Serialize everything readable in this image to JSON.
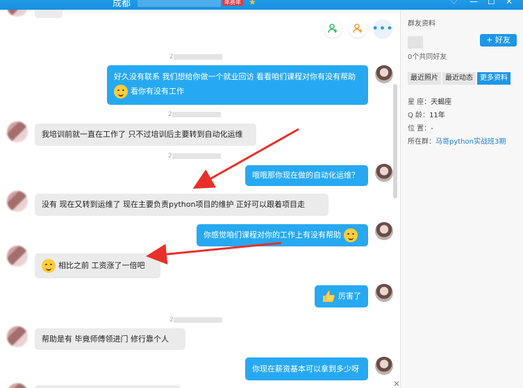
{
  "window": {
    "title_prefix": "成都",
    "vip_badge": "年费年",
    "controls": [
      "♡",
      "—",
      "☐",
      "✕"
    ]
  },
  "chat": {
    "messages": [
      {
        "side": "out",
        "text": "好久没有联系 我们想给你做一个就业回访 看看咱们课程对你有没有帮助",
        "text2": "看你有没有工作"
      },
      {
        "side": "in",
        "text": "我培训前就一直在工作了  只不过培训后主要转到自动化运维"
      },
      {
        "side": "out",
        "text": "哦哦那你现在做的自动化运维？"
      },
      {
        "side": "in",
        "text": "没有 现在又转到运维了  现在主要负责python项目的维护   正好可以跟着项目走"
      },
      {
        "side": "out",
        "text": "你感觉咱们课程对你的工作上有没有帮助"
      },
      {
        "side": "in",
        "text": "相比之前  工资涨了一倍吧"
      },
      {
        "side": "out",
        "text": "厉害了"
      },
      {
        "side": "in",
        "text": "帮助是有 毕竟师傅领进门  修行靠个人"
      },
      {
        "side": "out",
        "text": "你现在薪资基本可以拿到多少呀"
      }
    ],
    "timestamps": [
      "2",
      "2",
      "2",
      "2"
    ]
  },
  "panel": {
    "title": "群友资料",
    "add_friend": "+ 好友",
    "common_friends": "0个共同好友",
    "tabs": [
      "最近照片",
      "最近动态",
      "更多资料"
    ],
    "active_tab": 2,
    "info": {
      "constellation_label": "星  座：",
      "constellation": "天蝎座",
      "qage_label": "Q    龄：",
      "qage": "11年",
      "location_label": "位  置：",
      "location": "-",
      "group_label": "所在群：",
      "group": "马哥python实战班3期"
    }
  },
  "colors": {
    "accent": "#1d96e6",
    "bubble_out": "#27a9f2",
    "bubble_in": "#ebebeb",
    "arrow": "#e8302a"
  }
}
